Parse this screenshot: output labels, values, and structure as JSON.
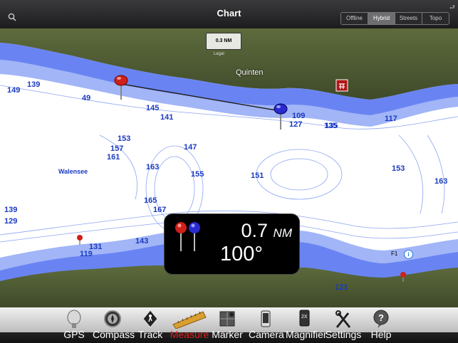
{
  "nav": {
    "title": "Chart",
    "map_types": [
      {
        "label": "Offline",
        "selected": false
      },
      {
        "label": "Hybrid",
        "selected": true
      },
      {
        "label": "Streets",
        "selected": false
      },
      {
        "label": "Topo",
        "selected": false
      }
    ]
  },
  "map": {
    "scale_label": "0.3 NM",
    "scale_sub": "Legal",
    "lake_name": "Walensee",
    "town_name": "Quinten",
    "marker_label": "F1",
    "depth_labels": [
      "149",
      "139",
      "49",
      "145",
      "141",
      "153",
      "157",
      "161",
      "147",
      "163",
      "155",
      "167",
      "165",
      "151",
      "139",
      "129",
      "143",
      "141",
      "135",
      "121",
      "109",
      "127",
      "135",
      "153",
      "163",
      "119",
      "131",
      "117"
    ]
  },
  "measure": {
    "distance_value": "0.7",
    "distance_unit": "NM",
    "bearing": "100°"
  },
  "toolbar": {
    "items": [
      {
        "label": "GPS",
        "icon": "gps-dish-icon",
        "active": false
      },
      {
        "label": "Compass",
        "icon": "compass-icon",
        "active": false
      },
      {
        "label": "Track",
        "icon": "track-sign-icon",
        "active": false
      },
      {
        "label": "Measure",
        "icon": "ruler-icon",
        "active": true
      },
      {
        "label": "Marker",
        "icon": "marker-grid-icon",
        "active": false
      },
      {
        "label": "Camera",
        "icon": "camera-icon",
        "active": false
      },
      {
        "label": "Magnifier",
        "icon": "magnifier-icon",
        "active": false
      },
      {
        "label": "Settings",
        "icon": "settings-tools-icon",
        "active": false
      },
      {
        "label": "Help",
        "icon": "help-bubble-icon",
        "active": false
      }
    ]
  },
  "colors": {
    "accent_active": "#e0221e",
    "depth_text": "#1a3ac0",
    "contour": "#6f8ff0"
  }
}
